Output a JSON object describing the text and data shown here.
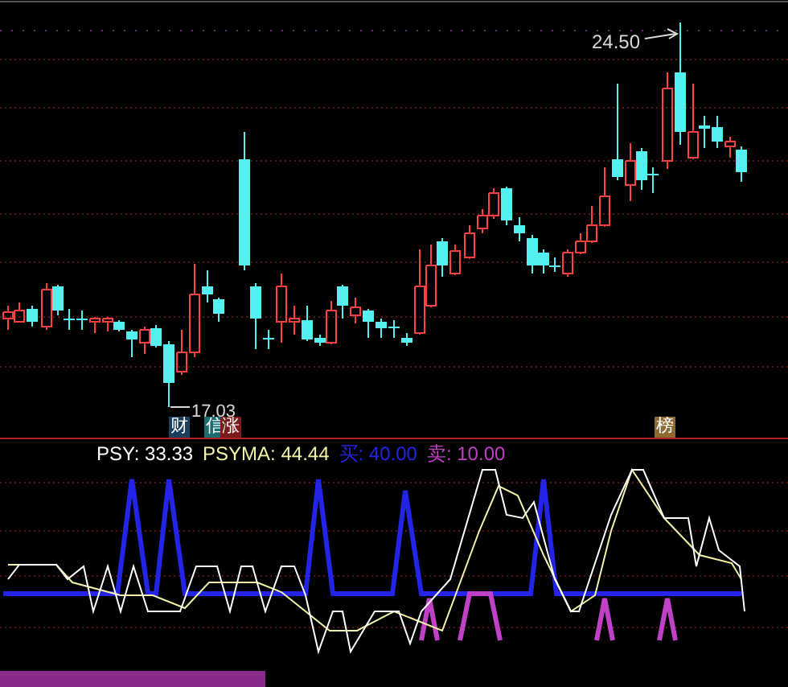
{
  "price_chart": {
    "high_label": "24.50",
    "low_label": "17.03",
    "badges": [
      {
        "text": "财",
        "color": "#1c3f5e"
      },
      {
        "text": "信",
        "color": "#1b6e6e"
      },
      {
        "text": "涨",
        "color": "#7a1c1c"
      },
      {
        "text": "榜",
        "color": "#8c6a32"
      }
    ]
  },
  "indicator": {
    "legend": [
      {
        "label": "PSY: 33.33",
        "color": "#ffffff"
      },
      {
        "label": "PSYMA: 44.44",
        "color": "#f2f2a8"
      },
      {
        "label": "买: 40.00",
        "color": "#2424e8"
      },
      {
        "label": "卖: 10.00",
        "color": "#c040c8"
      }
    ]
  }
}
